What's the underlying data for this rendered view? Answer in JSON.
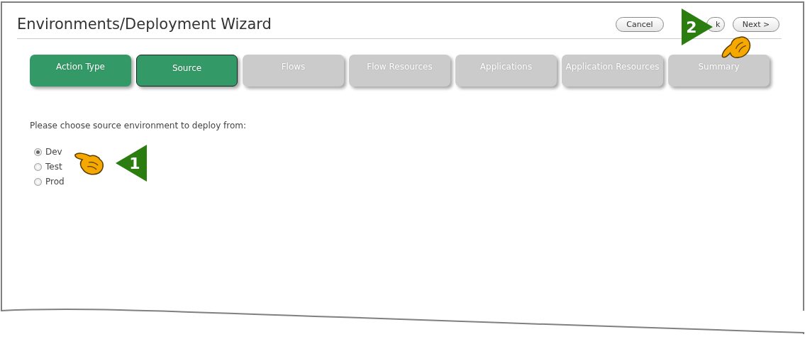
{
  "window": {
    "title": "Environments/Deployment Wizard"
  },
  "buttons": [
    {
      "label": "Cancel"
    },
    {
      "label": "k"
    },
    {
      "label": "Next >"
    }
  ],
  "steps": [
    {
      "label": "Action Type",
      "kind": "done"
    },
    {
      "label": "Source",
      "kind": "current"
    },
    {
      "label": "Flows",
      "kind": "pending"
    },
    {
      "label": "Flow Resources",
      "kind": "pending"
    },
    {
      "label": "Applications",
      "kind": "pending"
    },
    {
      "label": "Application Resources",
      "kind": "pending"
    },
    {
      "label": "Summary",
      "kind": "pending"
    }
  ],
  "prompt": "Please choose source environment to deploy from:",
  "environments": [
    {
      "label": "Dev",
      "selected": true
    },
    {
      "label": "Test",
      "selected": false
    },
    {
      "label": "Prod",
      "selected": false
    }
  ],
  "callouts": [
    {
      "number": "1",
      "kind": "left"
    },
    {
      "number": "2",
      "kind": "right"
    }
  ]
}
